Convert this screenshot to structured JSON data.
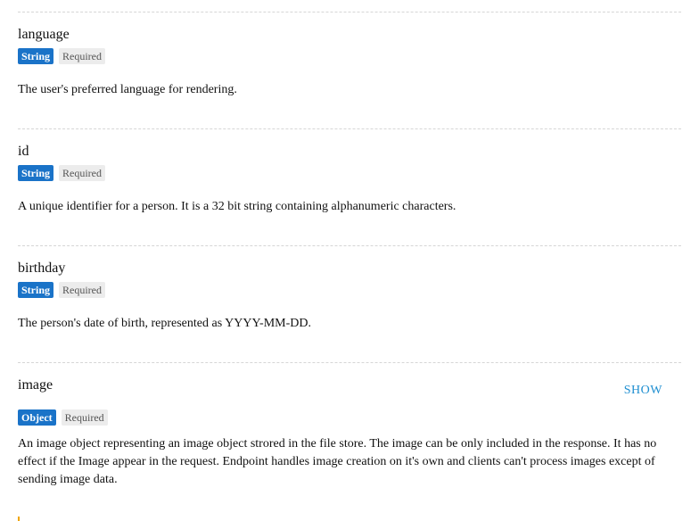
{
  "properties": [
    {
      "name": "language",
      "type": "String",
      "required": "Required",
      "description": "The user's preferred language for rendering."
    },
    {
      "name": "id",
      "type": "String",
      "required": "Required",
      "description": "A unique identifier for a person. It is a 32 bit string containing alphanumeric characters."
    },
    {
      "name": "birthday",
      "type": "String",
      "required": "Required",
      "description": "The person's date of birth, represented as YYYY-MM-DD."
    },
    {
      "name": "image",
      "type": "Object",
      "required": "Required",
      "show_label": "SHOW",
      "description": "An image object representing an image object strored in the file store. The image can be only included in the response. It has no effect if the Image appear in the request. Endpoint handles image creation on it's own and clients can't process images except of sending image data."
    }
  ],
  "colors": {
    "type_badge": "#1a73c8",
    "required_badge": "#ececec",
    "link": "#1f8fd1",
    "accent": "#f0a500"
  }
}
